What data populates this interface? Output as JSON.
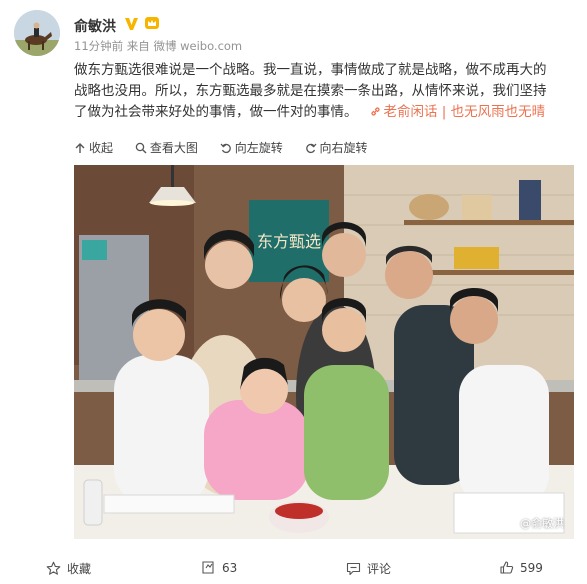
{
  "author": {
    "name": "俞敏洪",
    "meta": "11分钟前 来自 微博 weibo.com"
  },
  "post": {
    "lines": [
      "做东方甄选很难说是一个战略。我一直说，事情做成了就是战略，做不成再大的",
      "战略也没用。所以，东方甄选最多就是在摸索一条出路，从情怀来说，我们坚持",
      "了做为社会带来好处的事情，做一件对的事情。"
    ],
    "link_text": "老俞闲话 | 也无风雨也无晴"
  },
  "image_toolbar": {
    "collapse": "收起",
    "view_large": "查看大图",
    "rotate_left": "向左旋转",
    "rotate_right": "向右旋转"
  },
  "photo": {
    "sign_text": "东方甄选",
    "watermark": "@俞敏洪"
  },
  "actions": {
    "favorite": "收藏",
    "repost_count": "63",
    "comment": "评论",
    "like_count": "599"
  },
  "colors": {
    "link": "#eb7350",
    "badge": "#f7b500",
    "text": "#333333",
    "meta": "#939393"
  }
}
